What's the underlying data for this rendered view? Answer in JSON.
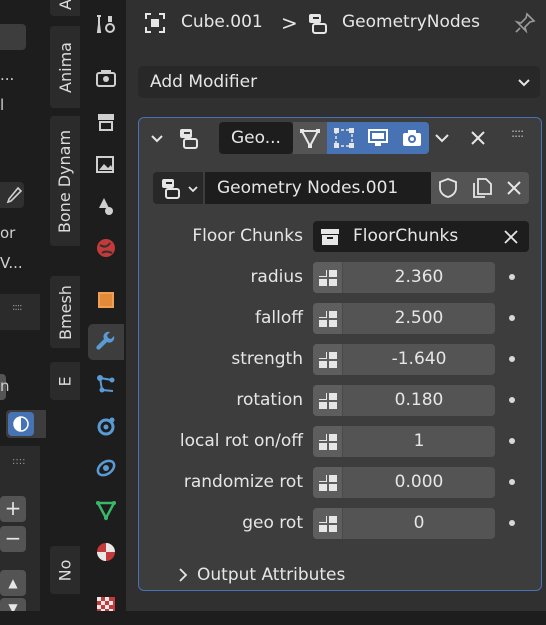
{
  "left_tabs": [
    "Anima",
    "Bone Dynam",
    "Bmesh",
    "E",
    "No",
    "A"
  ],
  "left_panel": {
    "text_or": "or",
    "text_v": "V...",
    "text_dots": "...",
    "text_bracket": "l",
    "text_n": "n"
  },
  "breadcrumb": {
    "object": "Cube.001",
    "separator": ">",
    "modifier": "GeometryNodes"
  },
  "add_modifier": {
    "label": "Add Modifier"
  },
  "modifier": {
    "name": "Geo...",
    "node_group": "Geometry Nodes.001",
    "properties": [
      {
        "label": "Floor Chunks",
        "value": "FloorChunks",
        "kind": "collection"
      },
      {
        "label": "radius",
        "value": "2.360"
      },
      {
        "label": "falloff",
        "value": "2.500"
      },
      {
        "label": "strength",
        "value": "-1.640"
      },
      {
        "label": "rotation",
        "value": "0.180"
      },
      {
        "label": "local rot on/off",
        "value": "1"
      },
      {
        "label": "randomize rot",
        "value": "0.000"
      },
      {
        "label": "geo rot",
        "value": "0"
      }
    ],
    "output_attributes": "Output Attributes"
  },
  "colors": {
    "accent": "#4772b3",
    "panel_bg": "#3d3d3d",
    "field_bg": "#545454",
    "dark_bg": "#1d1d1d"
  }
}
